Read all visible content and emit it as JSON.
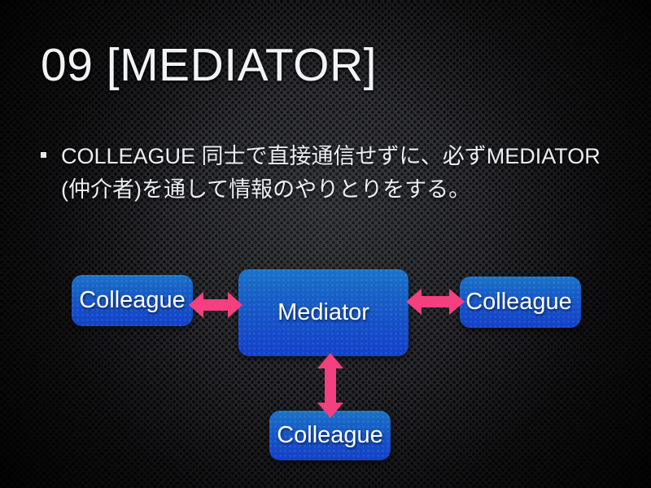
{
  "slide": {
    "title": "09 [MEDIATOR]",
    "bullet": {
      "marker": "square-bullet",
      "text": "COLLEAGUE 同士で直接通信せずに、必ずMEDIATOR(仲介者)を通して情報のやりとりをする。"
    }
  },
  "colors": {
    "background_dark": "#242424",
    "node_blue_top": "#1a74c8",
    "node_blue_bottom": "#1440c9",
    "arrow_pink": "#f4407f",
    "text_white": "#f2f3f5"
  },
  "diagram": {
    "type": "mediator-pattern",
    "nodes": [
      {
        "id": "mediator",
        "label": "Mediator"
      },
      {
        "id": "colleague-left",
        "label": "Colleague"
      },
      {
        "id": "colleague-right",
        "label": "Colleague"
      },
      {
        "id": "colleague-bottom",
        "label": "Colleague"
      }
    ],
    "connections": [
      {
        "from": "colleague-left",
        "to": "mediator",
        "style": "double-headed-arrow",
        "orientation": "horizontal"
      },
      {
        "from": "mediator",
        "to": "colleague-right",
        "style": "double-headed-arrow",
        "orientation": "horizontal"
      },
      {
        "from": "mediator",
        "to": "colleague-bottom",
        "style": "double-headed-arrow",
        "orientation": "vertical"
      }
    ]
  }
}
